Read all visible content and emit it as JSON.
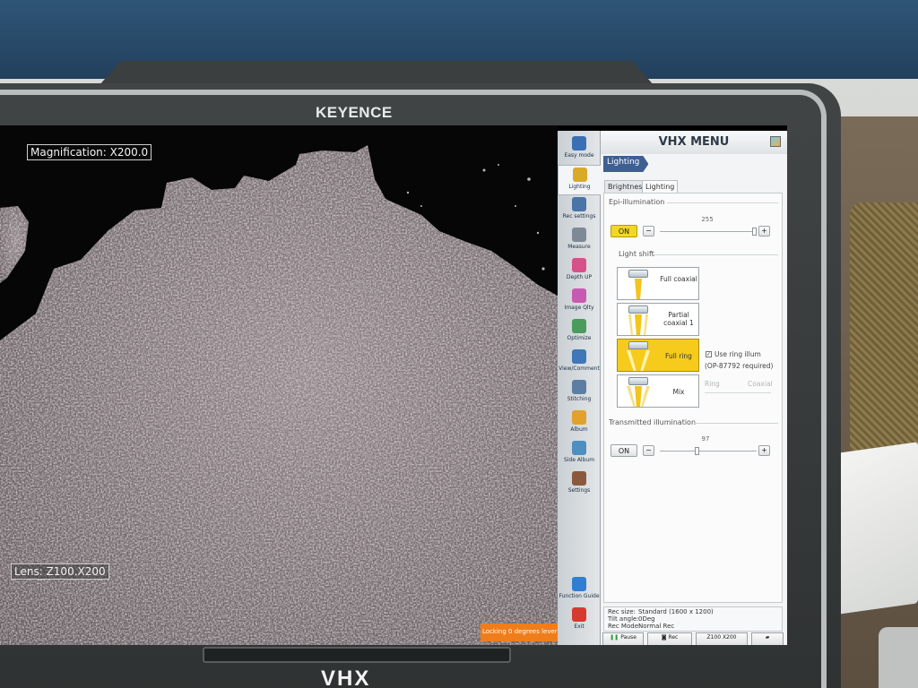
{
  "monitor": {
    "brand": "KEYENCE",
    "model_label": "VHX"
  },
  "viewer": {
    "magnification_label": "Magnification: X200.0",
    "lens_label": "Lens: Z100.X200",
    "lock_banner": "Locking 0 degrees lever"
  },
  "sidebar": {
    "items": [
      {
        "label": "Easy mode",
        "icon": "person-icon",
        "color": "#3b6fb5"
      },
      {
        "label": "Lighting",
        "icon": "lamp-icon",
        "color": "#d8a92a"
      },
      {
        "label": "Rec settings",
        "icon": "camera-settings-icon",
        "color": "#4a74a8"
      },
      {
        "label": "Measure",
        "icon": "ruler-icon",
        "color": "#7d8a96"
      },
      {
        "label": "Depth UP",
        "icon": "depth-icon",
        "color": "#d94f8a"
      },
      {
        "label": "Image Qlty",
        "icon": "image-quality-icon",
        "color": "#c85ab0"
      },
      {
        "label": "Optimize",
        "icon": "optimize-icon",
        "color": "#4a9b5c"
      },
      {
        "label": "View/Comment",
        "icon": "comment-icon",
        "color": "#3f77b8"
      },
      {
        "label": "Stitching",
        "icon": "stitch-icon",
        "color": "#5d7ea3"
      },
      {
        "label": "Album",
        "icon": "album-icon",
        "color": "#e2a12c"
      },
      {
        "label": "Side Album",
        "icon": "side-album-icon",
        "color": "#4d8fbf"
      },
      {
        "label": "Settings",
        "icon": "tools-icon",
        "color": "#8a5a3c"
      },
      {
        "label": "Function Guide",
        "icon": "help-icon",
        "color": "#2f7ed1"
      },
      {
        "label": "Exit",
        "icon": "power-icon",
        "color": "#d63a2f"
      }
    ]
  },
  "menu": {
    "title": "VHX MENU",
    "breadcrumb": "Lighting",
    "tabs": [
      {
        "label": "Brightness",
        "active": false
      },
      {
        "label": "Lighting",
        "active": true
      }
    ],
    "epi": {
      "title": "Epi-illumination",
      "on_label": "ON",
      "value": "255",
      "minus": "−",
      "plus": "+",
      "level_fraction": 1.0
    },
    "light_shift": {
      "title": "Light shift",
      "options": [
        {
          "label": "Full coaxial",
          "selected": false
        },
        {
          "label": "Partial coaxial 1",
          "selected": false
        },
        {
          "label": "Full ring",
          "selected": true
        },
        {
          "label": "Mix",
          "selected": false
        }
      ],
      "use_ring_label": "Use ring illum",
      "ring_note": "(OP-87792 required)",
      "ring_label": "Ring",
      "coaxial_label": "Coaxial"
    },
    "transmitted": {
      "title": "Transmitted illumination",
      "on_label": "ON",
      "value": "97",
      "minus": "−",
      "plus": "+",
      "level_fraction": 0.38
    },
    "status": {
      "rec_size_key": "Rec size:",
      "rec_size_val": "Standard (1600 x 1200)",
      "tilt_key": "Tilt angle:",
      "tilt_val": "0Deg",
      "mode_key": "Rec Mode:",
      "mode_val": "Normal Rec"
    },
    "footer": {
      "pause": "Pause",
      "rec": "Rec",
      "zoom": "Z100 X200"
    }
  }
}
